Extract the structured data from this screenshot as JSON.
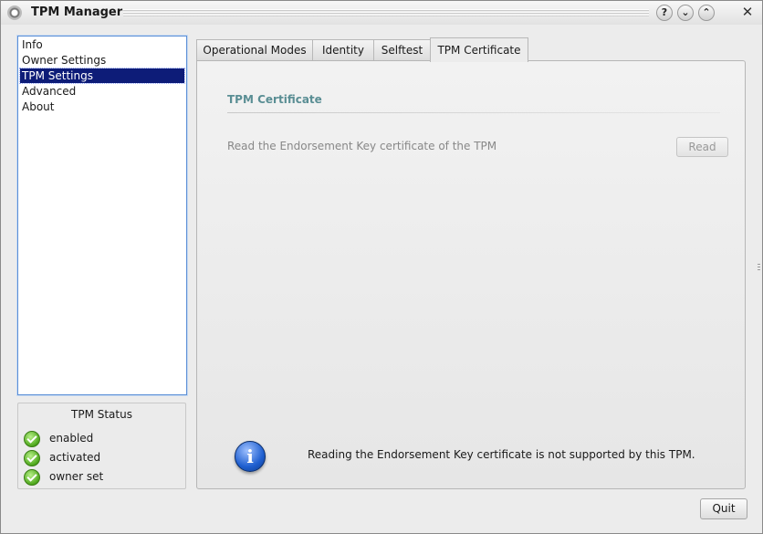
{
  "window": {
    "title": "TPM Manager",
    "help_button": "?",
    "minimize_button": "⌄",
    "maximize_button": "⌃",
    "close_button": "✕"
  },
  "nav": {
    "items": [
      {
        "label": "Info"
      },
      {
        "label": "Owner Settings"
      },
      {
        "label": "TPM Settings",
        "selected": true
      },
      {
        "label": "Advanced"
      },
      {
        "label": "About"
      }
    ]
  },
  "status": {
    "title": "TPM Status",
    "items": [
      {
        "label": "enabled",
        "icon": "check-icon"
      },
      {
        "label": "activated",
        "icon": "check-icon"
      },
      {
        "label": "owner set",
        "icon": "check-icon"
      }
    ]
  },
  "tabs": [
    {
      "label": "Operational Modes"
    },
    {
      "label": "Identity"
    },
    {
      "label": "Selftest"
    },
    {
      "label": "TPM Certificate",
      "active": true
    }
  ],
  "panel": {
    "section_title": "TPM Certificate",
    "description": "Read the Endorsement Key certificate of the TPM",
    "read_button": "Read",
    "info_icon": "i",
    "info_message": "Reading the Endorsement Key certificate is not supported by this TPM."
  },
  "footer": {
    "quit_button": "Quit"
  },
  "colors": {
    "selection": "#0d1c78",
    "section_title": "#5a8e94",
    "status_ok": "#4fa81d"
  }
}
